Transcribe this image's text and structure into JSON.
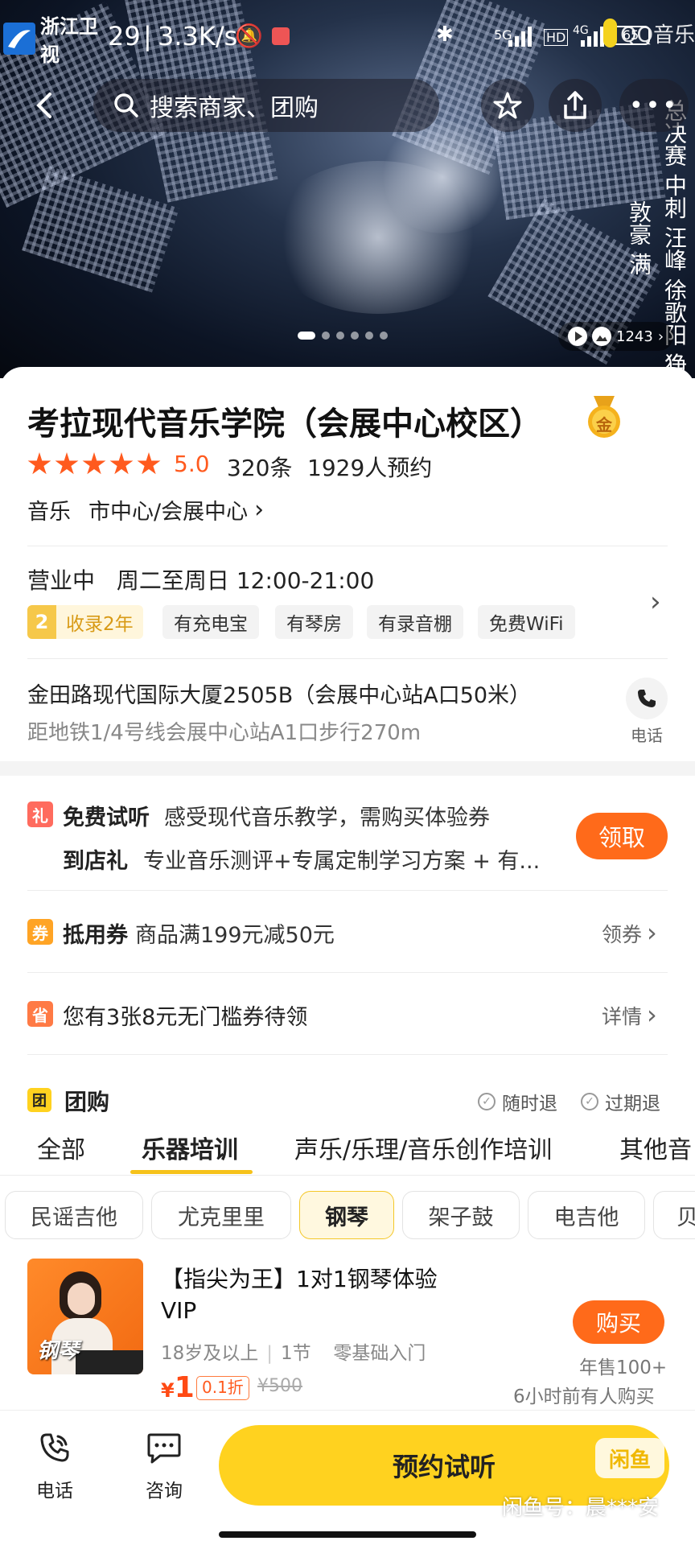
{
  "status_bar": {
    "time": "29",
    "speed": "3.3K/s",
    "battery": "65",
    "network": "5G",
    "signal": "4G"
  },
  "watermark": {
    "tv_logo": "浙江卫视",
    "qq_logo": "QQ音乐",
    "side_text": "总决赛 中刺 汪峰 徐歌阳 狰敦豪 满",
    "bottom": "闲鱼号：晨***安",
    "bottom_badge": "闲鱼"
  },
  "search": {
    "placeholder": "搜索商家、团购"
  },
  "gallery": {
    "views": "1243",
    "dots": 6
  },
  "shop": {
    "name": "考拉现代音乐学院（会展中心校区）",
    "medal": "金",
    "rating": "5.0",
    "reviews": "320条",
    "bookings": "1929人预约",
    "category": "音乐",
    "area": "市中心/会展中心",
    "hours_status": "营业中",
    "hours": "周二至周日 12:00-21:00",
    "years_num": "2",
    "years_label": "收录2年",
    "tags": [
      "有充电宝",
      "有琴房",
      "有录音棚",
      "免费WiFi"
    ],
    "address": "金田路现代国际大厦2505B（会展中心站A口50米）",
    "distance": "距地铁1/4号线会展中心站A1口步行270m",
    "phone_label": "电话"
  },
  "promos": {
    "gift_icon": "礼",
    "trial_title": "免费试听",
    "trial_desc": "感受现代音乐教学，需购买体验券",
    "store_title": "到店礼",
    "store_desc": "专业音乐测评+专属定制学习方案 + 有...",
    "claim_btn": "领取",
    "coupon_icon": "券",
    "coupon_title": "抵用券",
    "coupon_desc": "商品满199元减50元",
    "coupon_link": "领券",
    "save_icon": "省",
    "save_desc": "您有3张8元无门槛券待领",
    "save_link": "详情"
  },
  "group_buy": {
    "icon": "团",
    "title": "团购",
    "anytime": "随时退",
    "expired": "过期退",
    "tabs": [
      "全部",
      "乐器培训",
      "声乐/乐理/音乐创作培训",
      "其他音"
    ],
    "active_tab": 1,
    "chips": [
      "民谣吉他",
      "尤克里里",
      "钢琴",
      "架子鼓",
      "电吉他",
      "贝"
    ],
    "active_chip": 2
  },
  "product": {
    "title": "【指尖为王】1对1钢琴体验VIP",
    "title_line1": "【指尖为王】1对1钢琴体验",
    "title_line2": "VIP",
    "age": "18岁及以上",
    "lessons": "1节",
    "level": "零基础入门",
    "currency": "¥",
    "price": "1",
    "discount": "0.1折",
    "original": "¥500",
    "buy_btn": "购买",
    "sales": "年售100+",
    "recent": "6小时前有人购买",
    "thumb_text": "钢琴"
  },
  "bottom_bar": {
    "phone": "电话",
    "consult": "咨询",
    "book": "预约试听"
  }
}
